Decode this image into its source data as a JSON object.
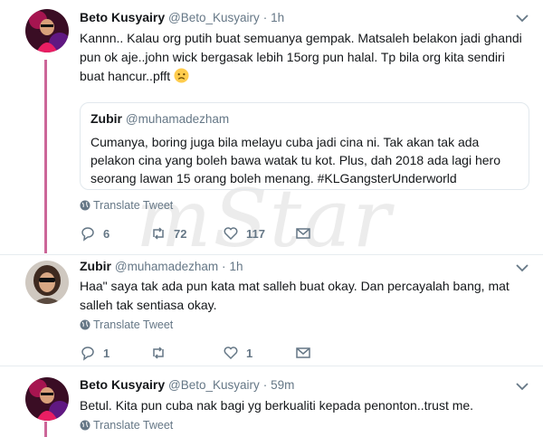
{
  "tweets": [
    {
      "name": "Beto Kusyairy",
      "handle": "@Beto_Kusyairy",
      "time": "1h",
      "text": "Kannn.. Kalau org putih buat semuanya gempak. Matsaleh belakon jadi ghandi pun ok aje..john wick bergasak lebih 15org pun halal. Tp bila org kita sendiri buat hancur..pfft",
      "quote": {
        "name": "Zubir",
        "handle": "@muhamadezham",
        "text": "Cumanya, boring juga bila melayu cuba jadi cina ni. Tak akan tak ada pelakon cina yang boleh bawa watak tu kot. Plus, dah 2018 ada lagi hero seorang lawan 15 orang boleh menang. #KLGangsterUnderworld"
      },
      "translate": "Translate Tweet",
      "replies": "6",
      "retweets": "72",
      "likes": "117"
    },
    {
      "name": "Zubir",
      "handle": "@muhamadezham",
      "time": "1h",
      "text": "Haa\" saya tak ada pun kata mat salleh buat okay. Dan percayalah bang, mat salleh tak sentiasa okay.",
      "translate": "Translate Tweet",
      "replies": "1",
      "retweets": "",
      "likes": "1"
    },
    {
      "name": "Beto Kusyairy",
      "handle": "@Beto_Kusyairy",
      "time": "59m",
      "text": "Betul. Kita pun cuba nak bagi yg berkualiti kepada penonton..trust me.",
      "translate": "Translate Tweet"
    }
  ],
  "separator": "·",
  "watermark": "mStar",
  "colors": {
    "thread_line": "#cc6699",
    "secondary_text": "#657786",
    "divider": "#e6ecf0"
  },
  "icons": [
    "chevron-down-icon",
    "globe-icon",
    "reply-icon",
    "retweet-icon",
    "like-icon",
    "message-icon",
    "sad-emoji-icon"
  ]
}
